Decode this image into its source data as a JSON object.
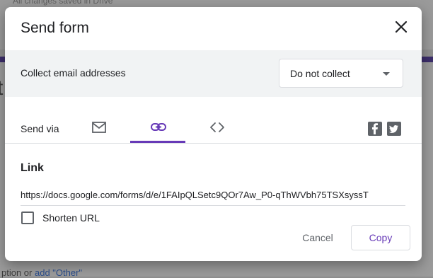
{
  "background": {
    "top_text": "All changes saved in Drive",
    "big_letter": "t",
    "bottom_text_prefix": "ption  or  ",
    "bottom_link": "add \"Other\""
  },
  "dialog": {
    "title": "Send form",
    "close_icon": "close-icon",
    "collect": {
      "label": "Collect email addresses",
      "selected": "Do not collect"
    },
    "send_via_label": "Send via",
    "tabs": [
      {
        "icon": "email-icon",
        "active": false
      },
      {
        "icon": "link-icon",
        "active": true
      },
      {
        "icon": "embed-code-icon",
        "active": false
      }
    ],
    "social": [
      "facebook-icon",
      "twitter-icon"
    ],
    "link": {
      "heading": "Link",
      "url": "https://docs.google.com/forms/d/e/1FAIpQLSetc9QOr7Aw_P0-qThWVbh75TSXsyssT",
      "shorten_label": "Shorten URL",
      "shorten_checked": false
    },
    "buttons": {
      "cancel": "Cancel",
      "copy": "Copy"
    }
  },
  "colors": {
    "accent": "#673ab7",
    "muted_bg": "#f1f3f4",
    "text": "#202124",
    "icon": "#5f6368"
  }
}
